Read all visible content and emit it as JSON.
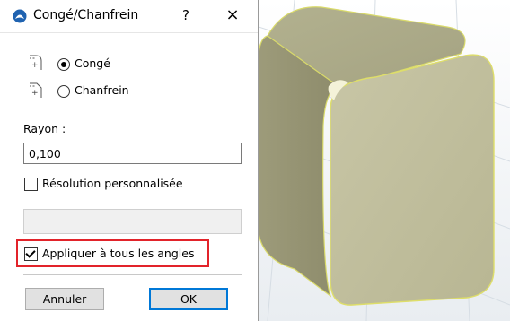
{
  "dialog": {
    "title": "Congé/Chanfrein",
    "help_label": "?",
    "close_label": "×",
    "options": [
      {
        "label": "Congé",
        "selected": true,
        "icon": "fillet-icon"
      },
      {
        "label": "Chanfrein",
        "selected": false,
        "icon": "chamfer-icon"
      }
    ],
    "radius_label": "Rayon :",
    "radius_value": "0,100",
    "custom_resolution_label": "Résolution personnalisée",
    "custom_resolution_checked": false,
    "apply_all_label": "Appliquer à tous les angles",
    "apply_all_checked": true,
    "cancel_label": "Annuler",
    "ok_label": "OK"
  },
  "colors": {
    "highlight": "#e2232a",
    "accent": "#0078d7",
    "cube_face": "#c2bf9c",
    "cube_edge": "#dede6a"
  }
}
